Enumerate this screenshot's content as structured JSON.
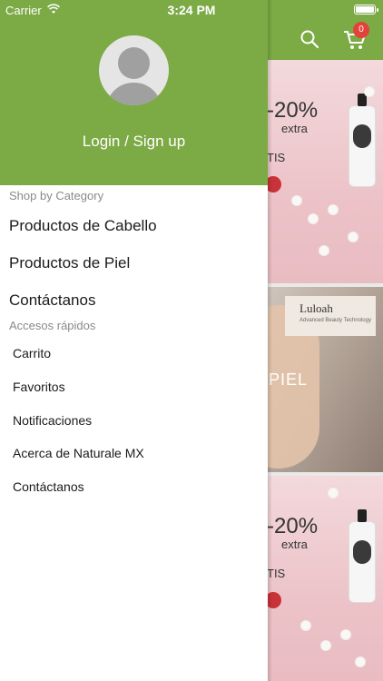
{
  "status_bar": {
    "carrier": "Carrier",
    "time": "3:24 PM"
  },
  "background_app": {
    "cart_count": "0",
    "banners": [
      {
        "discount": "-20%",
        "extra": "extra",
        "tag": "TIS"
      },
      {
        "brand": "Luloah",
        "tagline": "Advanced Beauty Technology",
        "label": "PIEL"
      },
      {
        "discount": "-20%",
        "extra": "extra",
        "tag": "TIS"
      }
    ],
    "colors": {
      "header": "#7caa45",
      "badge": "#e2423a"
    }
  },
  "drawer": {
    "login_label": "Login / Sign up",
    "shop_section_title": "Shop by Category",
    "categories": [
      {
        "label": "Productos de Cabello"
      },
      {
        "label": "Productos de Piel"
      },
      {
        "label": "Contáctanos"
      }
    ],
    "quick_section_title": "Accesos rápidos",
    "quick_links": [
      {
        "label": "Carrito"
      },
      {
        "label": "Favoritos"
      },
      {
        "label": "Notificaciones"
      },
      {
        "label": "Acerca de Naturale MX"
      },
      {
        "label": "Contáctanos"
      }
    ],
    "avatar_icon": "user-placeholder-icon"
  }
}
